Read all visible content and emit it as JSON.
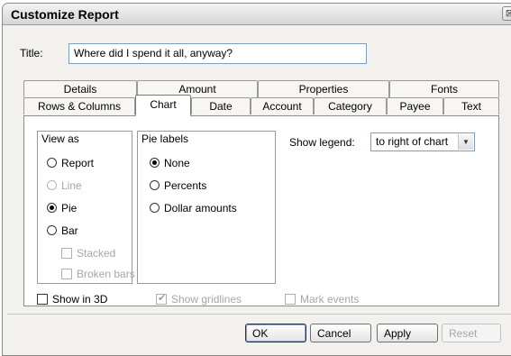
{
  "window": {
    "title": "Customize Report",
    "close_glyph": "⊠"
  },
  "report_title": {
    "label": "Title:",
    "value": "Where did I spend it all, anyway?"
  },
  "tabs_back": [
    "Details",
    "Amount",
    "Properties",
    "Fonts"
  ],
  "tabs_front": [
    "Rows & Columns",
    "Chart",
    "Date",
    "Account",
    "Category",
    "Payee",
    "Text"
  ],
  "active_tab": "Chart",
  "view_as": {
    "label": "View as",
    "options": [
      "Report",
      "Line",
      "Pie",
      "Bar"
    ],
    "selected": "Pie",
    "sub_options": [
      "Stacked",
      "Broken bars"
    ]
  },
  "pie_labels": {
    "label": "Pie labels",
    "options": [
      "None",
      "Percents",
      "Dollar amounts"
    ],
    "selected": "None"
  },
  "show_legend": {
    "label": "Show legend:",
    "value": "to right of chart"
  },
  "checkboxes": {
    "show_3d": "Show in 3D",
    "show_gridlines": "Show gridlines",
    "mark_events": "Mark events"
  },
  "buttons": {
    "ok": "OK",
    "cancel": "Cancel",
    "apply": "Apply",
    "reset": "Reset"
  }
}
